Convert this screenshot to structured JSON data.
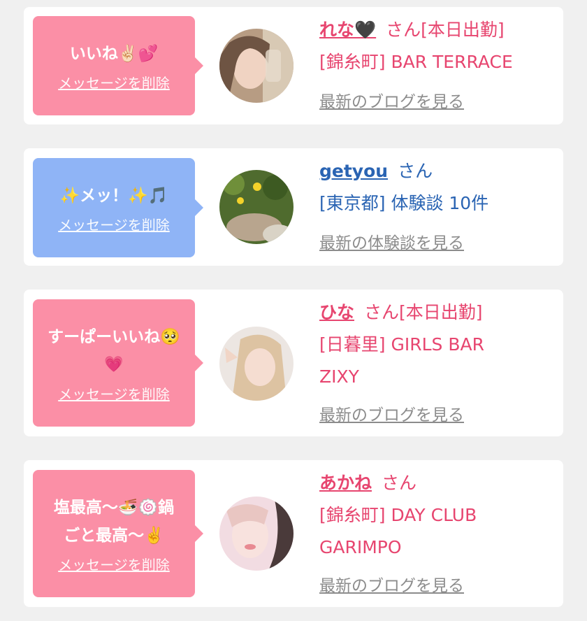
{
  "items": [
    {
      "message_line1": "いいね✌🏻💕",
      "message_line2": "",
      "delete_label": "メッセージを削除",
      "name": "れな🖤",
      "suffix": "さん[本日出勤]",
      "detail_line1": "[錦糸町] BAR TERRACE",
      "detail_line2": "",
      "link_label": "最新のブログを見る"
    },
    {
      "message_line1": "✨メッ！✨🎵",
      "message_line2": "",
      "delete_label": "メッセージを削除",
      "name": "getyou",
      "suffix": "さん",
      "detail_line1": "[東京都] 体験談 10件",
      "detail_line2": "",
      "link_label": "最新の体験談を見る"
    },
    {
      "message_line1": "すーぱーいいね🥺",
      "message_line2": "💗",
      "delete_label": "メッセージを削除",
      "name": "ひな",
      "suffix": "さん[本日出勤]",
      "detail_line1": "[日暮里] GIRLS BAR",
      "detail_line2": "ZIXY",
      "link_label": "最新のブログを見る"
    },
    {
      "message_line1": "塩最高〜🍜🍥鍋",
      "message_line2": "ごと最高〜✌️",
      "delete_label": "メッセージを削除",
      "name": "あかね",
      "suffix": "さん",
      "detail_line1": "[錦糸町] DAY CLUB",
      "detail_line2": "GARIMPO",
      "link_label": "最新のブログを見る"
    }
  ],
  "colors": {
    "pink_bubble": "#fb8fa6",
    "blue_bubble": "#8fb4f6",
    "pink_text": "#e7456f",
    "blue_text": "#2a64b3",
    "link_gray": "#8c8c8c",
    "background": "#f0f0f0"
  }
}
